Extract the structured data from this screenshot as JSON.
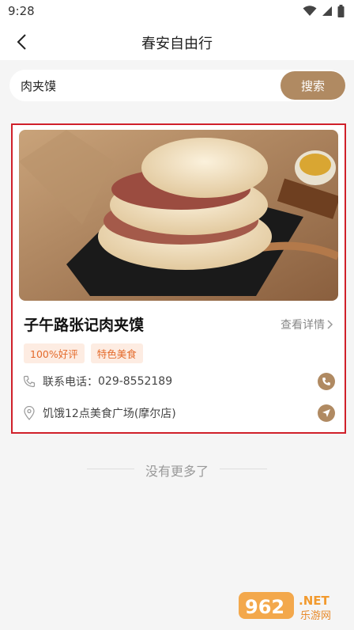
{
  "status_bar": {
    "time": "9:28"
  },
  "nav": {
    "title": "春安自由行"
  },
  "search": {
    "value": "肉夹馍",
    "button_label": "搜索"
  },
  "result": {
    "name": "子午路张记肉夹馍",
    "detail_label": "查看详情",
    "tags": [
      "100%好评",
      "特色美食"
    ],
    "phone_label": "联系电话：",
    "phone": "029-8552189",
    "address": "饥饿12点美食广场(摩尔店)"
  },
  "list_end_text": "没有更多了",
  "watermark": {
    "number": "962",
    "suffix": ".NET",
    "site": "乐游网"
  },
  "colors": {
    "accent": "#b08a62",
    "tag_bg": "#fdece2",
    "tag_text": "#e46b2c",
    "highlight": "#d0202a"
  }
}
